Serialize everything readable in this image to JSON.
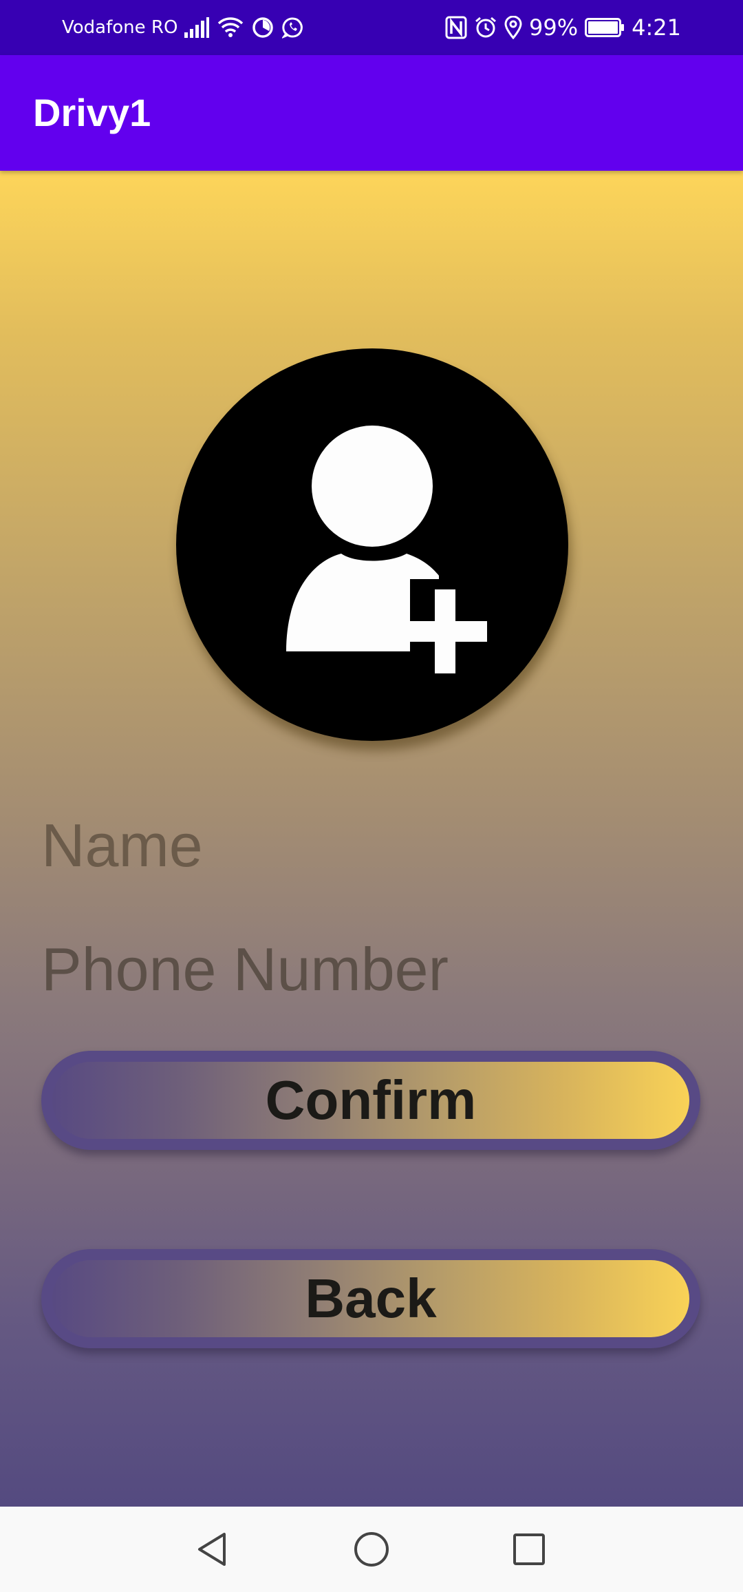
{
  "status_bar": {
    "carrier": "Vodafone RO",
    "battery": "99%",
    "time": "4:21",
    "icons_left": [
      "signal-icon",
      "wifi-icon",
      "timer-icon",
      "whatsapp-icon"
    ],
    "icons_right": [
      "nfc-icon",
      "alarm-icon",
      "location-icon",
      "battery-icon"
    ]
  },
  "app_bar": {
    "title": "Drivy1"
  },
  "form": {
    "avatar_icon": "add-user-icon",
    "name_placeholder": "Name",
    "phone_placeholder": "Phone Number",
    "confirm_label": "Confirm",
    "back_label": "Back"
  },
  "nav_bar": {
    "icons": [
      "back-triangle-icon",
      "home-circle-icon",
      "recents-square-icon"
    ]
  },
  "colors": {
    "status_bar": "#3700b3",
    "app_bar": "#6200ee",
    "gradient_top": "#fdd55a",
    "gradient_bottom": "#544a80",
    "button_border": "#584a85",
    "button_gradient_end": "#f9d257"
  }
}
